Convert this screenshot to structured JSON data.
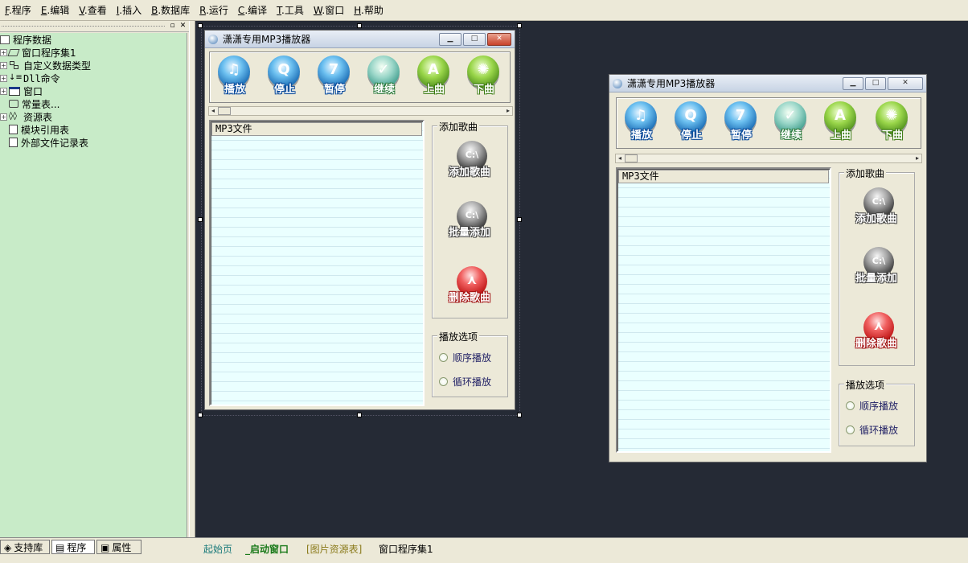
{
  "menubar": {
    "items": [
      {
        "key": "F",
        "label": ".程序"
      },
      {
        "key": "E",
        "label": ".编辑"
      },
      {
        "key": "V",
        "label": ".查看"
      },
      {
        "key": "I",
        "label": ".插入"
      },
      {
        "key": "B",
        "label": ".数据库"
      },
      {
        "key": "R",
        "label": ".运行"
      },
      {
        "key": "C",
        "label": ".编译"
      },
      {
        "key": "T",
        "label": ".工具"
      },
      {
        "key": "W",
        "label": ".窗口"
      },
      {
        "key": "H",
        "label": ".帮助"
      }
    ]
  },
  "tree": {
    "root": "程序数据",
    "items": [
      {
        "label": "窗口程序集1",
        "expand": "+"
      },
      {
        "label": "自定义数据类型",
        "expand": "+"
      },
      {
        "label": "Dll命令",
        "expand": "+"
      },
      {
        "label": "窗口",
        "expand": "+"
      },
      {
        "label": "常量表...",
        "expand": ""
      },
      {
        "label": "资源表",
        "expand": "+"
      },
      {
        "label": "模块引用表",
        "expand": ""
      },
      {
        "label": "外部文件记录表",
        "expand": ""
      }
    ]
  },
  "left_tabs": [
    "支持库",
    "程序",
    "属性"
  ],
  "doc_tabs": [
    "起始页",
    "_启动窗口",
    "[图片资源表]",
    "窗口程序集1"
  ],
  "player": {
    "title": "潇潇专用MP3播放器",
    "toolbar": [
      "播放",
      "停止",
      "暂停",
      "继续",
      "上曲",
      "下曲"
    ],
    "list_header": "MP3文件",
    "add_group": "添加歌曲",
    "add_buttons": [
      "添加歌曲",
      "批量添加",
      "删除歌曲"
    ],
    "options_group": "播放选项",
    "options": [
      "顺序播放",
      "循环播放"
    ],
    "button_glyph": "C:\\"
  },
  "colors": {
    "tree_bg": "#c8ebc8",
    "designer_bg": "#252a35",
    "list_bg": "#eaffff"
  }
}
